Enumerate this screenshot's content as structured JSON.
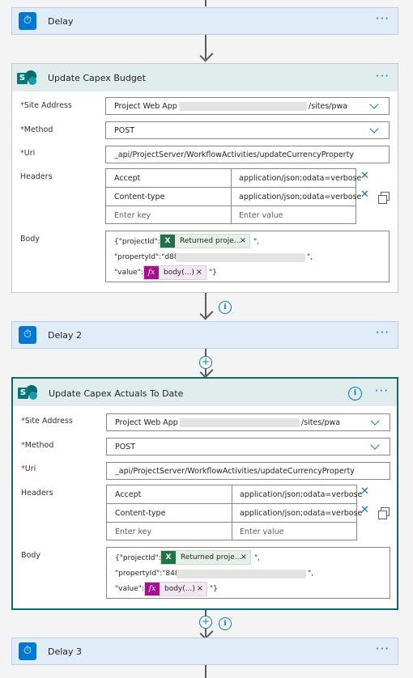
{
  "delay1": {
    "title": "Delay"
  },
  "action1": {
    "title": "Update Capex Budget",
    "site_label": "Site Address",
    "site_prefix": "Project Web App -",
    "site_suffix": "/sites/pwa",
    "method_label": "Method",
    "method_value": "POST",
    "uri_label": "Uri",
    "uri_value": "_api/ProjectServer/WorkflowActivities/updateCurrencyProperty",
    "headers_label": "Headers",
    "headers": [
      {
        "key": "Accept",
        "value": "application/json;odata=verbose"
      },
      {
        "key": "Content-type",
        "value": "application/json;odata=verbose"
      }
    ],
    "key_placeholder": "Enter key",
    "value_placeholder": "Enter value",
    "body_label": "Body",
    "body_line1_prefix": "{\"projectId\":\"",
    "token_excel_label": "Returned proje...",
    "body_line1_suffix": "\",",
    "body_line2_prefix": "\"propertyId\":\"d88",
    "body_line2_suffix": "\",",
    "body_line3_prefix": "\"value\":\"",
    "token_fx_label": "body(...)",
    "body_line3_suffix": "\"}"
  },
  "delay2": {
    "title": "Delay 2"
  },
  "action2": {
    "title": "Update Capex Actuals To Date",
    "site_label": "Site Address",
    "site_prefix": "Project Web App -",
    "site_suffix": "/sites/pwa",
    "method_label": "Method",
    "method_value": "POST",
    "uri_label": "Uri",
    "uri_value": "_api/ProjectServer/WorkflowActivities/updateCurrencyProperty",
    "headers_label": "Headers",
    "headers": [
      {
        "key": "Accept",
        "value": "application/json;odata=verbose"
      },
      {
        "key": "Content-type",
        "value": "application/json;odata=verbose"
      }
    ],
    "key_placeholder": "Enter key",
    "value_placeholder": "Enter value",
    "body_label": "Body",
    "body_line1_prefix": "{\"projectId\":\"",
    "token_excel_label": "Returned proje...",
    "body_line1_suffix": "\",",
    "body_line2_prefix": "\"propertyId\":\"848",
    "body_line2_suffix": "\",",
    "body_line3_prefix": "\"value\":\"",
    "token_fx_label": "body(...)",
    "body_line3_suffix": "\"}"
  },
  "delay3": {
    "title": "Delay 3"
  },
  "glyphs": {
    "more": "···",
    "close": "✕",
    "token_close": "×",
    "info": "i",
    "plus": "+",
    "required": "*",
    "timer": "⏱",
    "excel": "X",
    "fx": "fx",
    "sp": "S"
  },
  "colors": {
    "accent": "#0078d4",
    "selected_border": "#0e6b68",
    "required": "#a4262c",
    "excel": "#217346",
    "fx": "#a80f8c"
  }
}
